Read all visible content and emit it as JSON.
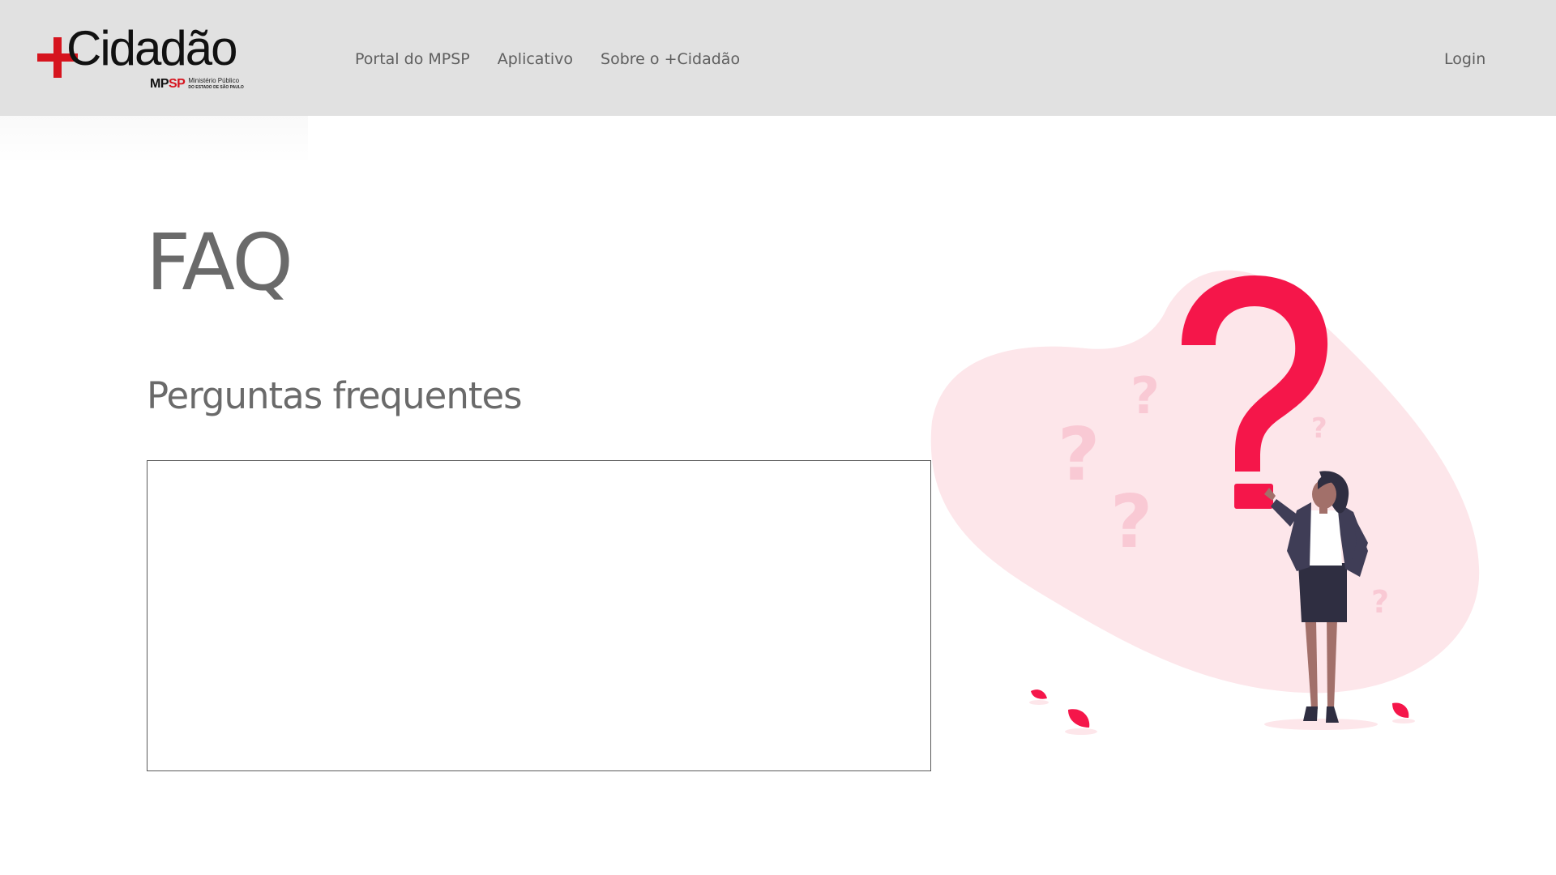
{
  "brand": {
    "logo_text": "Cidadão",
    "logo_prefix": "+",
    "logo_mp": "MP",
    "logo_sp": "SP",
    "logo_line1": "Ministério Público",
    "logo_line2": "DO ESTADO DE SÃO PAULO",
    "accent_color": "#d6141e"
  },
  "nav": {
    "items": [
      {
        "label": "Portal do MPSP"
      },
      {
        "label": "Aplicativo"
      },
      {
        "label": "Sobre o +Cidadão"
      }
    ],
    "login_label": "Login"
  },
  "main": {
    "title": "FAQ",
    "subtitle": "Perguntas frequentes"
  },
  "illustration": {
    "icon": "woman-question-mark-illustration",
    "primary_color": "#f5164a",
    "blob_color": "#fde6ea"
  }
}
